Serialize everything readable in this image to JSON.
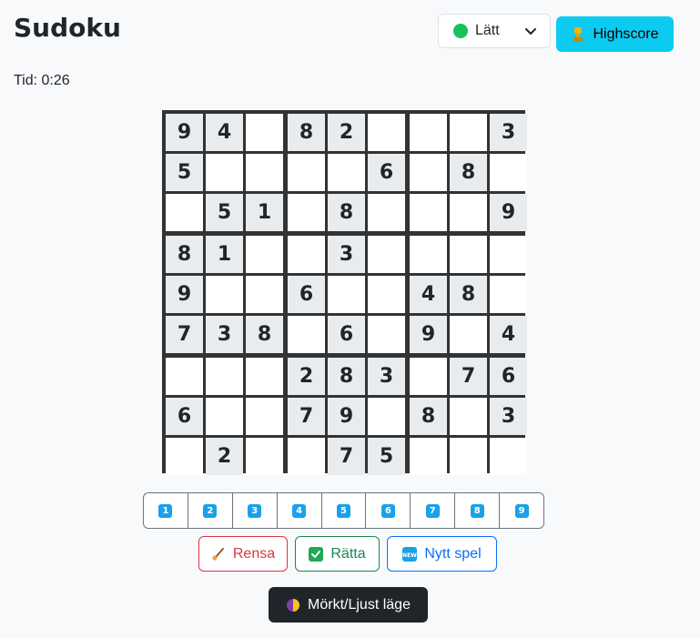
{
  "header": {
    "title": "Sudoku",
    "difficulty": {
      "selected": "Lätt",
      "indicator_color": "#19c15b"
    },
    "highscore_label": "Highscore"
  },
  "timer": {
    "label": "Tid:",
    "value": "0:26"
  },
  "board": {
    "rows": [
      [
        "9",
        "4",
        "",
        "8",
        "2",
        "",
        "",
        "",
        "3"
      ],
      [
        "5",
        "",
        "",
        "",
        "",
        "6",
        "",
        "8",
        ""
      ],
      [
        "",
        "5",
        "1",
        "",
        "8",
        "",
        "",
        "",
        "9"
      ],
      [
        "8",
        "1",
        "",
        "",
        "3",
        "",
        "",
        "",
        ""
      ],
      [
        "9",
        "",
        "",
        "6",
        "",
        "",
        "4",
        "8",
        ""
      ],
      [
        "7",
        "3",
        "8",
        "",
        "6",
        "",
        "9",
        "",
        "4"
      ],
      [
        "",
        "",
        "",
        "2",
        "8",
        "3",
        "",
        "7",
        "6"
      ],
      [
        "6",
        "",
        "",
        "7",
        "9",
        "",
        "8",
        "",
        "3"
      ],
      [
        "",
        "2",
        "",
        "",
        "7",
        "5",
        "",
        "",
        ""
      ]
    ],
    "given_color": "#e9ecef",
    "empty_color": "#ffffff"
  },
  "numpad": {
    "numbers": [
      "1",
      "2",
      "3",
      "4",
      "5",
      "6",
      "7",
      "8",
      "9"
    ],
    "icon": "keycap-number-icon"
  },
  "actions": {
    "clear_label": "Rensa",
    "check_label": "Rätta",
    "new_label": "Nytt spel",
    "theme_label": "Mörkt/Ljust läge"
  },
  "colors": {
    "highscore_bg": "#0dcaf0",
    "clear": "#dc3545",
    "check": "#198754",
    "new": "#0d6efd",
    "theme_bg": "#212529"
  }
}
